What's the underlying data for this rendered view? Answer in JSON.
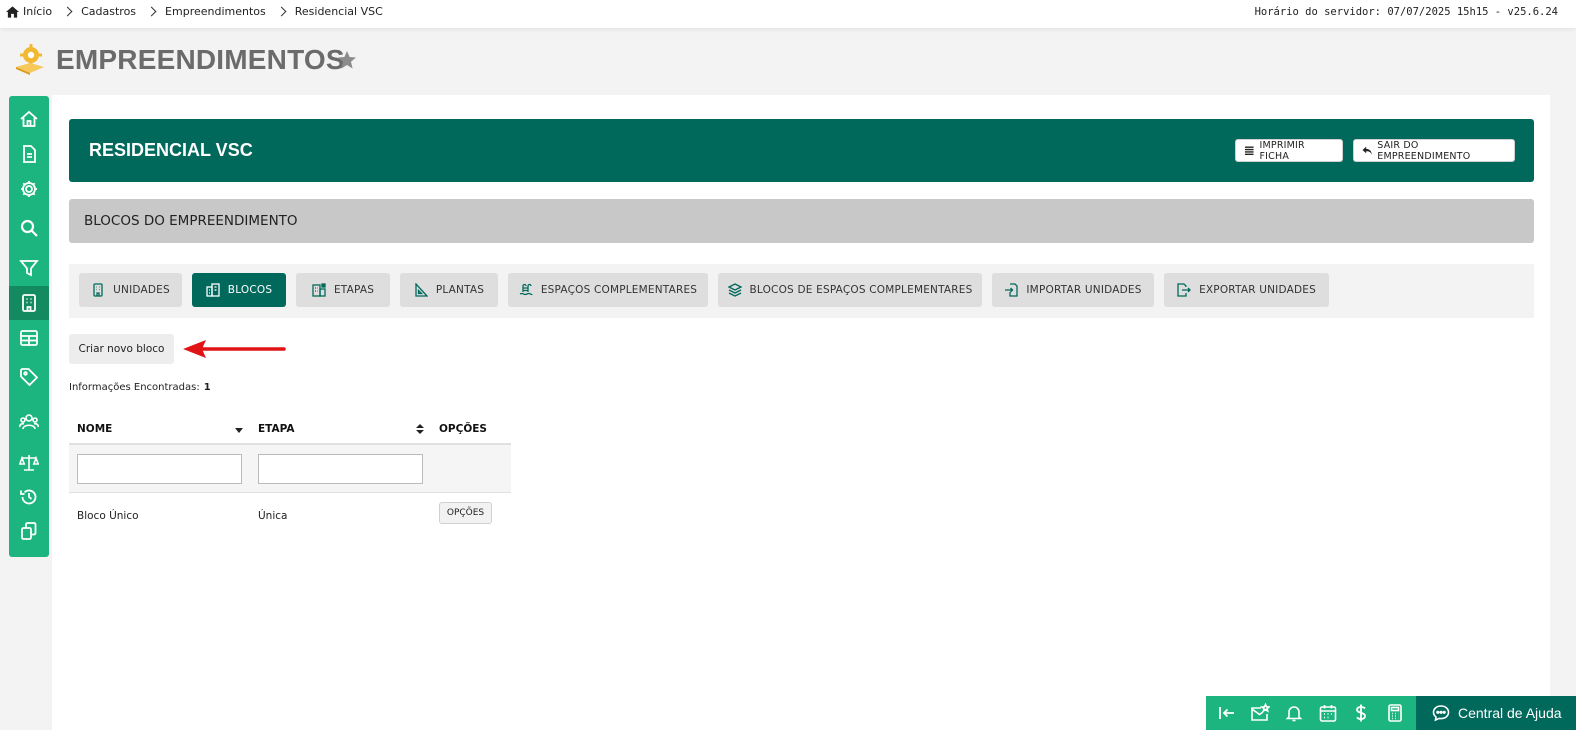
{
  "breadcrumb": {
    "items": [
      "Início",
      "Cadastros",
      "Empreendimentos",
      "Residencial VSC"
    ]
  },
  "server_time": "Horário do servidor: 07/07/2025 15h15 - v25.6.24",
  "page": {
    "title": "EMPREENDIMENTOS"
  },
  "banner": {
    "title": "RESIDENCIAL VSC",
    "print_label": "IMPRIMIR FICHA",
    "exit_label": "SAIR DO EMPREENDIMENTO"
  },
  "section": {
    "title": "BLOCOS DO EMPREENDIMENTO"
  },
  "tabs": [
    {
      "label": "UNIDADES",
      "icon": "building-icon"
    },
    {
      "label": "BLOCOS",
      "icon": "blocks-icon",
      "active": true
    },
    {
      "label": "ETAPAS",
      "icon": "stages-icon"
    },
    {
      "label": "PLANTAS",
      "icon": "ruler-icon"
    },
    {
      "label": "ESPAÇOS COMPLEMENTARES",
      "icon": "pool-icon"
    },
    {
      "label": "BLOCOS DE ESPAÇOS COMPLEMENTARES",
      "icon": "layers-icon"
    },
    {
      "label": "IMPORTAR UNIDADES",
      "icon": "import-icon"
    },
    {
      "label": "EXPORTAR UNIDADES",
      "icon": "export-icon"
    }
  ],
  "actions": {
    "new_block_label": "Criar novo bloco"
  },
  "info": {
    "label": "Informações Encontradas:",
    "count": "1"
  },
  "table": {
    "columns": [
      "NOME",
      "ETAPA",
      "OPÇÕES"
    ],
    "rows": [
      {
        "nome": "Bloco Único",
        "etapa": "Única",
        "opcoes": "OPÇÕES"
      }
    ]
  },
  "help": {
    "label": "Central de Ajuda"
  },
  "colors": {
    "primary": "#00695c",
    "accent": "#1db57f",
    "arrow": "#e01414"
  }
}
